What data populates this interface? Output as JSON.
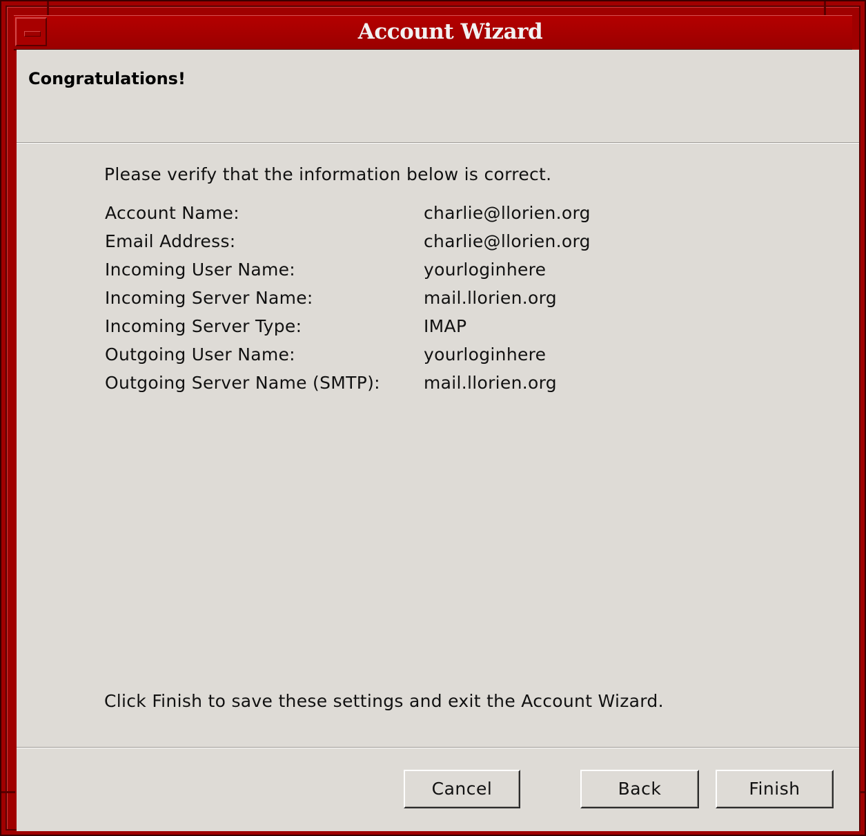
{
  "window": {
    "title": "Account Wizard"
  },
  "page": {
    "heading": "Congratulations!",
    "intro": "Please verify that the information below is correct.",
    "summary": [
      {
        "label": "Account Name:",
        "value": "charlie@llorien.org"
      },
      {
        "label": "Email Address:",
        "value": "charlie@llorien.org"
      },
      {
        "label": "Incoming User Name:",
        "value": "yourloginhere"
      },
      {
        "label": "Incoming Server Name:",
        "value": "mail.llorien.org"
      },
      {
        "label": "Incoming Server Type:",
        "value": "IMAP"
      },
      {
        "label": "Outgoing User Name:",
        "value": "yourloginhere"
      },
      {
        "label": "Outgoing Server Name (SMTP):",
        "value": "mail.llorien.org"
      }
    ],
    "outro": "Click Finish to save these settings and exit the Account Wizard."
  },
  "buttons": {
    "cancel": "Cancel",
    "back": "Back",
    "finish": "Finish"
  },
  "colors": {
    "frame": "#a00000",
    "client_background": "#dedbd6"
  }
}
